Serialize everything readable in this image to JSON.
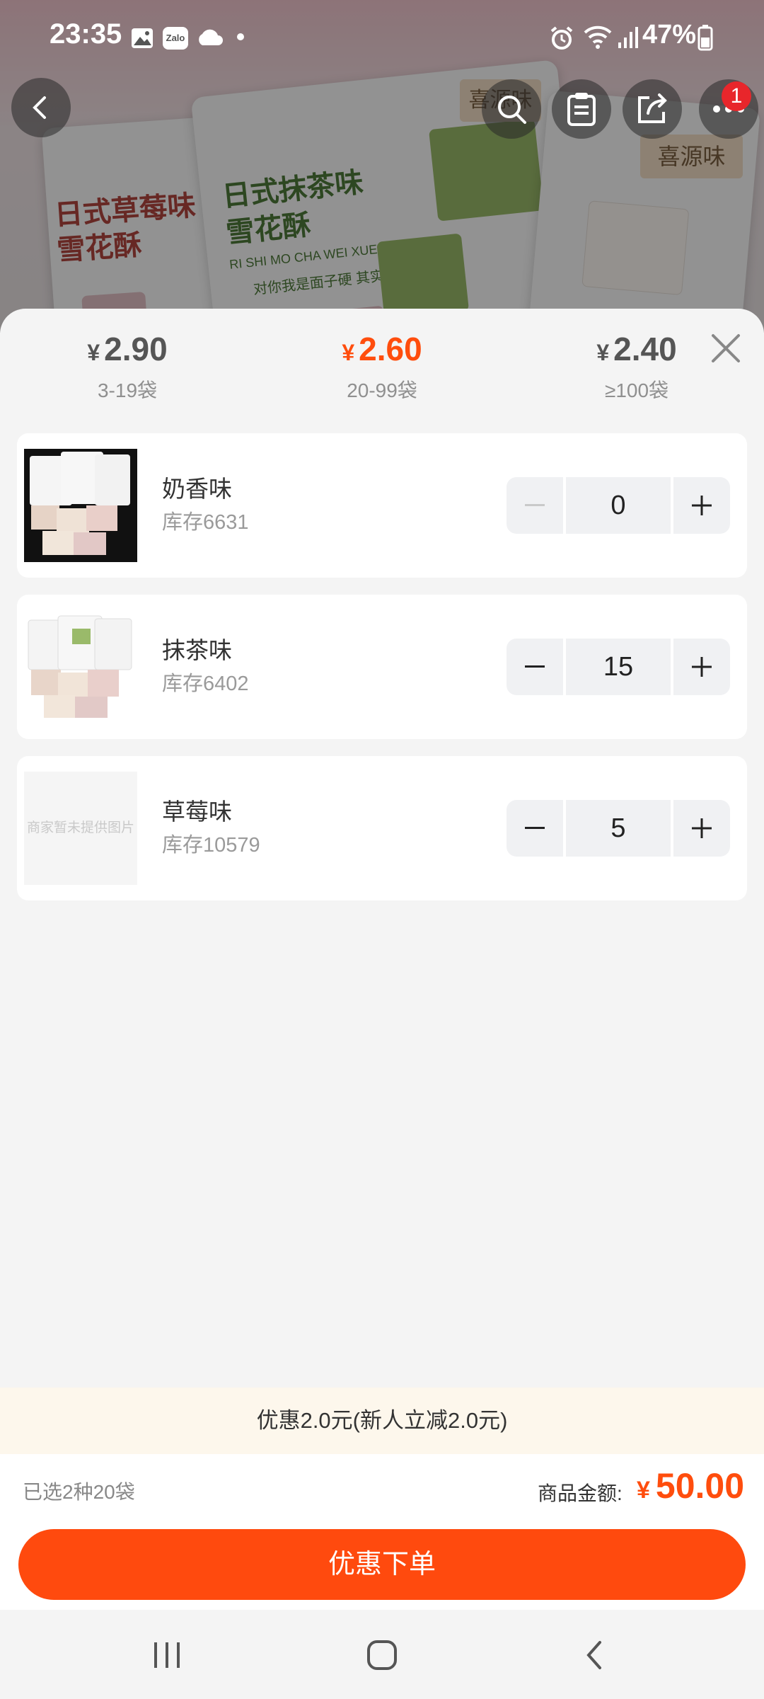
{
  "status_bar": {
    "time": "23:35",
    "battery": "47%",
    "icons": [
      "gallery-icon",
      "zalo-icon",
      "cloud-icon",
      "dot-icon",
      "alarm-icon",
      "wifi-icon",
      "signal-icon",
      "battery-icon"
    ],
    "zalo_text": "Zalo"
  },
  "product_image": {
    "bag_left_title": "日式草莓味",
    "bag_left_sub": "雪花酥",
    "bag_center_title": "日式抹茶味",
    "bag_center_sub": "雪花酥",
    "pinyin": "RI SHI MO CHA WEI XUE HUA SU",
    "slogan": "对你我是面子硬 其实心里",
    "brand": "喜源味"
  },
  "top_bar": {
    "icons": [
      "back-icon",
      "search-icon",
      "clipboard-icon",
      "share-icon",
      "more-icon"
    ],
    "badge": "1"
  },
  "price_tiers": [
    {
      "currency": "¥",
      "price": "2.90",
      "range": "3-19袋",
      "active": false
    },
    {
      "currency": "¥",
      "price": "2.60",
      "range": "20-99袋",
      "active": true
    },
    {
      "currency": "¥",
      "price": "2.40",
      "range": "≥100袋",
      "active": false
    }
  ],
  "variants": [
    {
      "name": "奶香味",
      "stock": "库存6631",
      "quantity": "0",
      "minus_enabled": false
    },
    {
      "name": "抹茶味",
      "stock": "库存6402",
      "quantity": "15",
      "minus_enabled": true
    },
    {
      "name": "草莓味",
      "stock": "库存10579",
      "quantity": "5",
      "minus_enabled": true,
      "placeholder": "商家暂未提供图片"
    }
  ],
  "promo": "优惠2.0元(新人立减2.0元)",
  "footer": {
    "selected": "已选2种20袋",
    "amount_label": "商品金额:",
    "currency": "¥",
    "amount": "50.00",
    "order_button": "优惠下单"
  },
  "colors": {
    "accent": "#ff4d0d",
    "promo_bg": "#fdf7ec"
  }
}
